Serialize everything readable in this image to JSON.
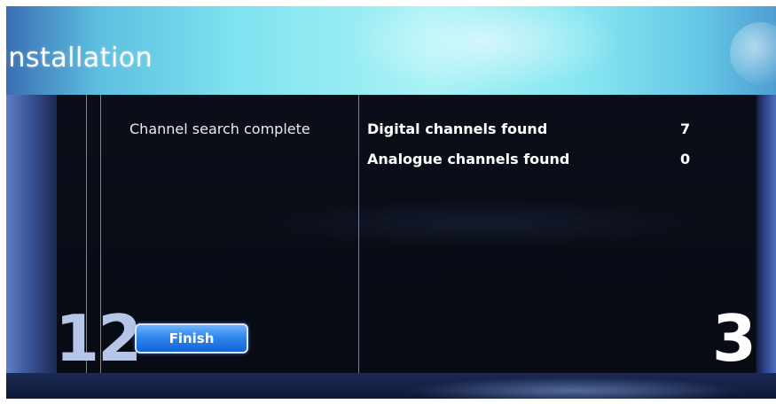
{
  "header": {
    "title": "Installation"
  },
  "wizard": {
    "completed_steps": "12",
    "current_step": "3"
  },
  "status": {
    "message": "Channel search complete"
  },
  "results": [
    {
      "label": "Digital channels found",
      "value": "7"
    },
    {
      "label": "Analogue channels found",
      "value": "0"
    }
  ],
  "actions": {
    "finish_label": "Finish"
  },
  "colors": {
    "accent": "#2f86ee",
    "banner": "#a9f2f6",
    "panel": "#0b0e18"
  }
}
